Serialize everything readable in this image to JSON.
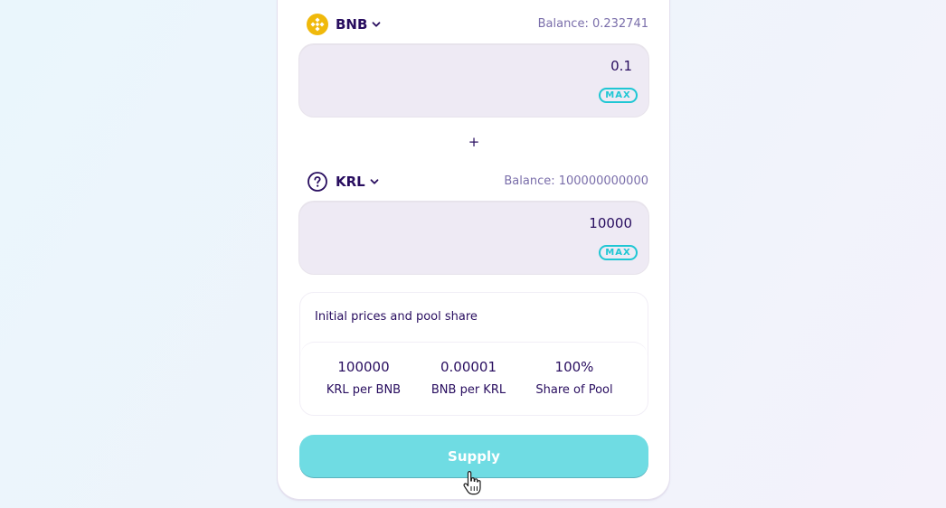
{
  "token_a": {
    "symbol": "BNB",
    "icon": "bnb-logo-icon",
    "balance": "Balance: 0.232741",
    "amount": "0.1",
    "max_label": "MAX"
  },
  "plus_sign": "+",
  "token_b": {
    "symbol": "KRL",
    "icon": "unknown-token-icon",
    "balance": "Balance: 100000000000",
    "amount": "10000",
    "max_label": "MAX"
  },
  "pool": {
    "title": "Initial prices and pool share",
    "stats": [
      {
        "value": "100000",
        "label": "KRL per BNB"
      },
      {
        "value": "0.00001",
        "label": "BNB per KRL"
      },
      {
        "value": "100%",
        "label": "Share of Pool"
      }
    ]
  },
  "supply_label": "Supply",
  "colors": {
    "primary": "#1fc7d4",
    "text": "#280d5f",
    "muted": "#7a6eaa",
    "input_bg": "#eeeaf4",
    "supply_bg": "#6fdce3",
    "bnb_yellow": "#f0b90b"
  }
}
